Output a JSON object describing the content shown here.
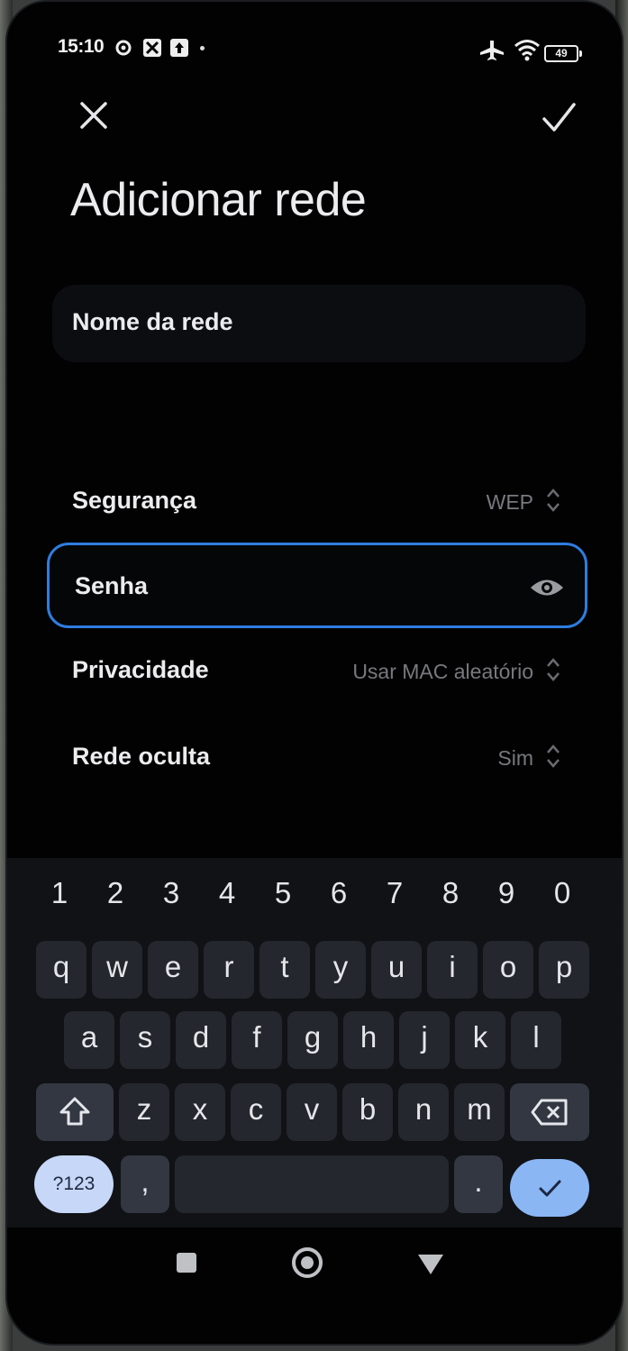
{
  "status_bar": {
    "time": "15:10",
    "battery": "49"
  },
  "header": {
    "title": "Adicionar rede"
  },
  "form": {
    "network_name_placeholder": "Nome da rede",
    "security_label": "Segurança",
    "security_value": "WEP",
    "password_label": "Senha",
    "privacy_label": "Privacidade",
    "privacy_value": "Usar MAC aleatório",
    "hidden_label": "Rede oculta",
    "hidden_value": "Sim"
  },
  "keyboard": {
    "numbers": [
      "1",
      "2",
      "3",
      "4",
      "5",
      "6",
      "7",
      "8",
      "9",
      "0"
    ],
    "row1": [
      "q",
      "w",
      "e",
      "r",
      "t",
      "y",
      "u",
      "i",
      "o",
      "p"
    ],
    "row2": [
      "a",
      "s",
      "d",
      "f",
      "g",
      "h",
      "j",
      "k",
      "l"
    ],
    "row3": [
      "z",
      "x",
      "c",
      "v",
      "b",
      "n",
      "m"
    ],
    "symbols_label": "?123",
    "comma_label": ",",
    "period_label": "."
  },
  "colors": {
    "focus_border": "#2f7de0",
    "enter_key": "#8ab6f4",
    "symbols_key": "#c7d7f7"
  }
}
